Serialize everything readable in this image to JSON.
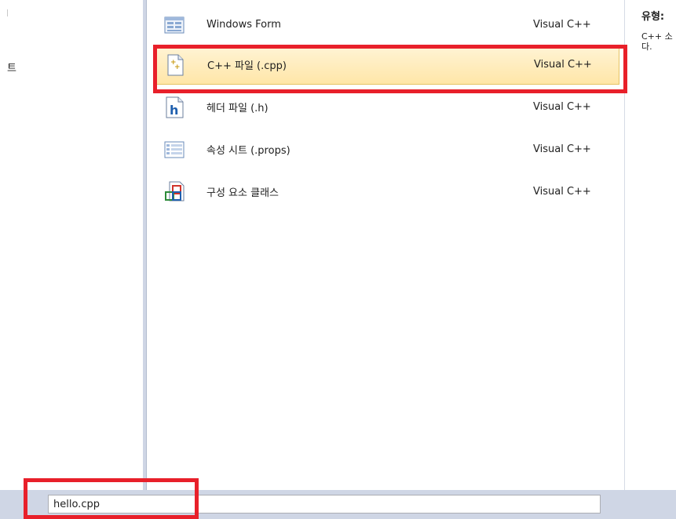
{
  "category_pane": {
    "selected_category_fragment": "트"
  },
  "templates": [
    {
      "name": "Windows Form",
      "type": "Visual C++",
      "icon": "windows-form-icon",
      "selected": false
    },
    {
      "name": "C++ 파일 (.cpp)",
      "type": "Visual C++",
      "icon": "cpp-file-icon",
      "selected": true
    },
    {
      "name": "헤더 파일 (.h)",
      "type": "Visual C++",
      "icon": "header-file-icon",
      "selected": false
    },
    {
      "name": "속성 시트 (.props)",
      "type": "Visual C++",
      "icon": "property-sheet-icon",
      "selected": false
    },
    {
      "name": "구성 요소 클래스",
      "type": "Visual C++",
      "icon": "component-class-icon",
      "selected": false
    }
  ],
  "info": {
    "type_label": "유형:",
    "description_line1": "C++ 소",
    "description_line2": "다."
  },
  "name_field": {
    "value": "hello.cpp"
  },
  "colors": {
    "selection_bg": "#ffe6a8",
    "selection_border": "#e5c365",
    "highlight_red": "#e8202a",
    "bottom_bar": "#cfd6e5"
  }
}
